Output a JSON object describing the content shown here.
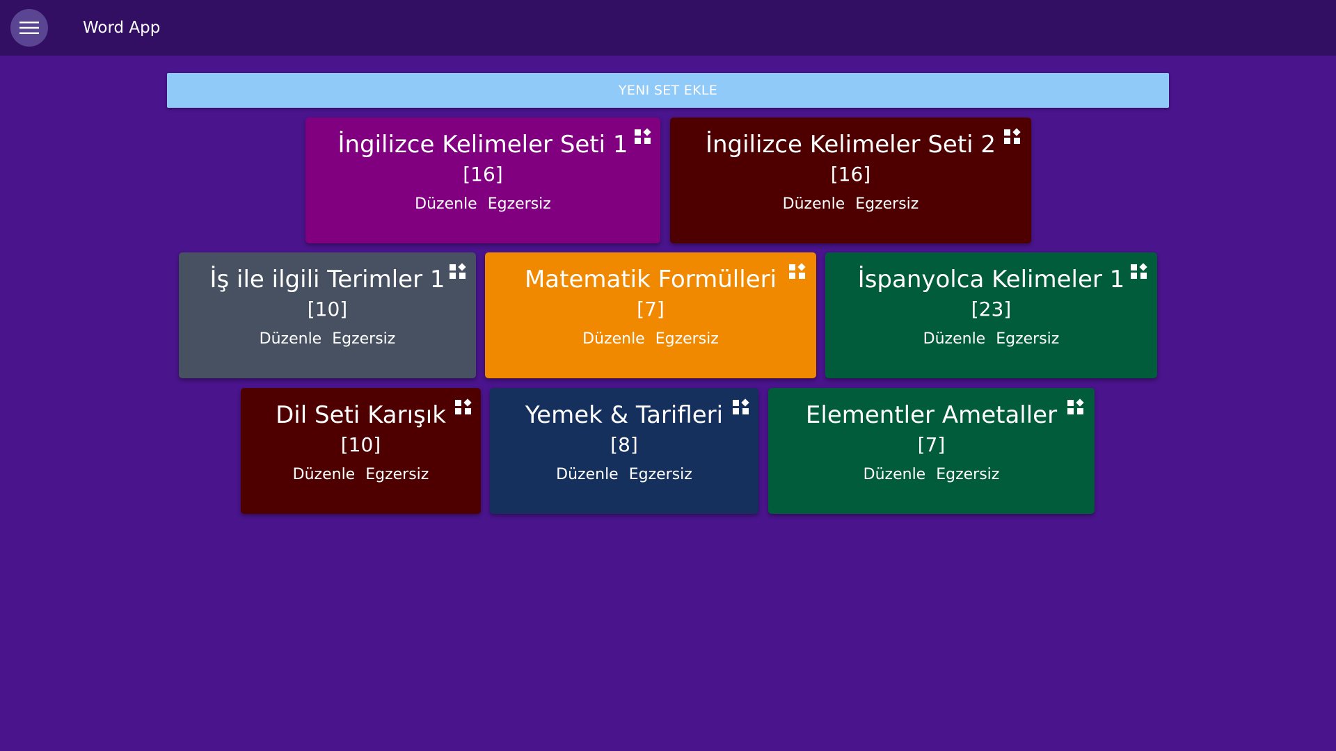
{
  "app": {
    "title": "Word App",
    "menu_icon": "hamburger-menu-icon"
  },
  "actions": {
    "add_set_label": "YENI SET EKLE"
  },
  "card_icon": "widgets-icon",
  "sets": [
    {
      "title": "İngilizce Kelimeler Seti 1",
      "count": "[16]",
      "edit_label": "Düzenle",
      "exercise_label": "Egzersiz",
      "color": "#800080"
    },
    {
      "title": "İngilizce Kelimeler Seti 2",
      "count": "[16]",
      "edit_label": "Düzenle",
      "exercise_label": "Egzersiz",
      "color": "#4e0000"
    },
    {
      "title": "İş ile ilgili Terimler 1",
      "count": "[10]",
      "edit_label": "Düzenle",
      "exercise_label": "Egzersiz",
      "color": "#475161"
    },
    {
      "title": "Matematik Formülleri",
      "count": "[7]",
      "edit_label": "Düzenle",
      "exercise_label": "Egzersiz",
      "color": "#f08900"
    },
    {
      "title": "İspanyolca Kelimeler 1",
      "count": "[23]",
      "edit_label": "Düzenle",
      "exercise_label": "Egzersiz",
      "color": "#005c3a"
    },
    {
      "title": "Dil Seti Karışık",
      "count": "[10]",
      "edit_label": "Düzenle",
      "exercise_label": "Egzersiz",
      "color": "#4e0000"
    },
    {
      "title": "Yemek & Tarifleri",
      "count": "[8]",
      "edit_label": "Düzenle",
      "exercise_label": "Egzersiz",
      "color": "#15305c"
    },
    {
      "title": "Elementler Ametaller",
      "count": "[7]",
      "edit_label": "Düzenle",
      "exercise_label": "Egzersiz",
      "color": "#005c3a"
    }
  ]
}
